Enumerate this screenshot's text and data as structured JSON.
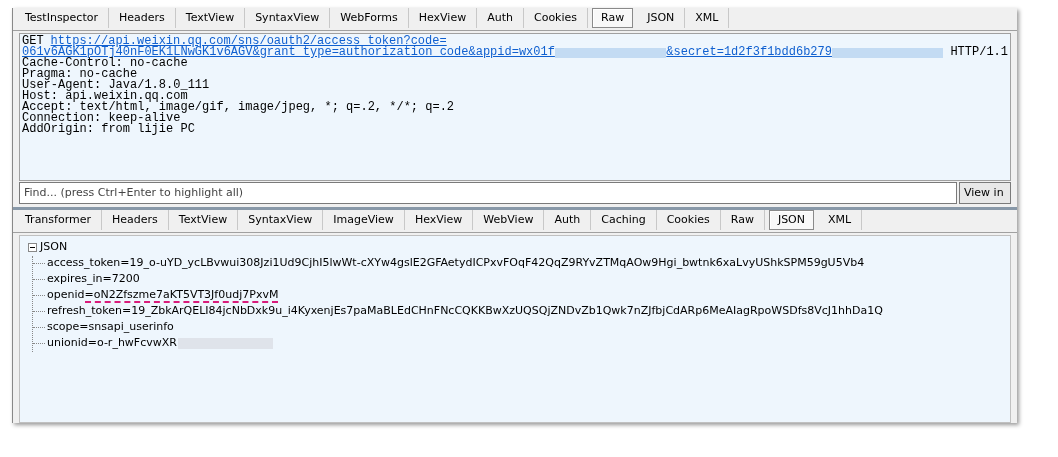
{
  "request_tabs": [
    {
      "label": "TestInspector",
      "selected": false
    },
    {
      "label": "Headers",
      "selected": false
    },
    {
      "label": "TextView",
      "selected": false
    },
    {
      "label": "SyntaxView",
      "selected": false
    },
    {
      "label": "WebForms",
      "selected": false
    },
    {
      "label": "HexView",
      "selected": false
    },
    {
      "label": "Auth",
      "selected": false
    },
    {
      "label": "Cookies",
      "selected": false
    },
    {
      "label": "Raw",
      "selected": true
    },
    {
      "label": "JSON",
      "selected": false
    },
    {
      "label": "XML",
      "selected": false
    }
  ],
  "request": {
    "method": "GET",
    "url_lines": [
      [
        {
          "kind": "link",
          "text": "https://api.weixin.qq.com/sns/oauth2/access_token?code="
        }
      ],
      [
        {
          "kind": "link",
          "text": "061v6AGK1pOTj40nF0EK1LNwGK1v6AGV&grant_type=authorization_code&appid=wx01f"
        },
        {
          "kind": "redacted"
        },
        {
          "kind": "link",
          "text": "&secret=1d2f3f1bdd6b279"
        },
        {
          "kind": "redacted"
        },
        {
          "kind": "text",
          "text": "HTTP/1.1"
        }
      ]
    ],
    "headers": [
      "Cache-Control: no-cache",
      "Pragma: no-cache",
      "User-Agent: Java/1.8.0_111",
      "Host: api.weixin.qq.com",
      "Accept: text/html, image/gif, image/jpeg, *; q=.2, */*; q=.2",
      "Connection: keep-alive",
      "AddOrigin: from lijie PC"
    ]
  },
  "find": {
    "placeholder": "Find... (press Ctrl+Enter to highlight all)",
    "button": "View in"
  },
  "response_tabs": [
    {
      "label": "Transformer",
      "selected": false
    },
    {
      "label": "Headers",
      "selected": false
    },
    {
      "label": "TextView",
      "selected": false
    },
    {
      "label": "SyntaxView",
      "selected": false
    },
    {
      "label": "ImageView",
      "selected": false
    },
    {
      "label": "HexView",
      "selected": false
    },
    {
      "label": "WebView",
      "selected": false
    },
    {
      "label": "Auth",
      "selected": false
    },
    {
      "label": "Caching",
      "selected": false
    },
    {
      "label": "Cookies",
      "selected": false
    },
    {
      "label": "Raw",
      "selected": false
    },
    {
      "label": "JSON",
      "selected": true
    },
    {
      "label": "XML",
      "selected": false
    }
  ],
  "tree": {
    "label": "JSON",
    "expanded": true,
    "children": [
      {
        "label": "access_token=19_o-uYD_ycLBvwui308Jzi1Ud9CjhI5lwWt-cXYw4gslE2GFAetydICPxvFOqF42QqZ9RYvZTMqAOw9Hgi_bwtnk6xaLvyUShkSPM59gU5Vb4",
        "marked": false,
        "redacted": false
      },
      {
        "label": "expires_in=7200",
        "marked": false,
        "redacted": false
      },
      {
        "label": "openid=oN2Zfszme7aKT5VT3Jf0udj7PxvM",
        "marked": true,
        "redacted": false
      },
      {
        "label": "refresh_token=19_ZbkArQELI84jcNbDxk9u_i4KyxenjEs7paMaBLEdCHnFNcCQKKBwXzUQSQjZNDvZb1Qwk7nZJfbjCdARp6MeAIagRpoWSDfs8VcJ1hhDa1Q",
        "marked": false,
        "redacted": false
      },
      {
        "label": "scope=snsapi_userinfo",
        "marked": false,
        "redacted": false
      },
      {
        "label": "unionid=o-r_hwFcvwXR",
        "marked": false,
        "redacted": true
      }
    ]
  }
}
